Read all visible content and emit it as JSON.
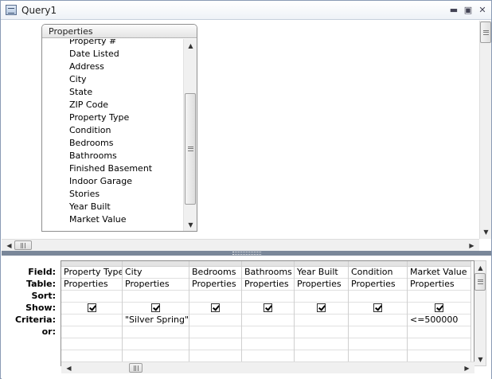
{
  "window": {
    "title": "Query1"
  },
  "field_list": {
    "title": "Properties",
    "items": [
      "Property #",
      "Date Listed",
      "Address",
      "City",
      "State",
      "ZIP Code",
      "Property Type",
      "Condition",
      "Bedrooms",
      "Bathrooms",
      "Finished Basement",
      "Indoor Garage",
      "Stories",
      "Year Built",
      "Market Value"
    ]
  },
  "grid": {
    "row_labels": [
      "Field:",
      "Table:",
      "Sort:",
      "Show:",
      "Criteria:",
      "or:"
    ],
    "columns": [
      {
        "field": "Property Type",
        "table": "Properties",
        "sort": "",
        "show": true,
        "criteria": "",
        "or": ""
      },
      {
        "field": "City",
        "table": "Properties",
        "sort": "",
        "show": true,
        "criteria": "\"Silver Spring\"",
        "or": ""
      },
      {
        "field": "Bedrooms",
        "table": "Properties",
        "sort": "",
        "show": true,
        "criteria": "",
        "or": ""
      },
      {
        "field": "Bathrooms",
        "table": "Properties",
        "sort": "",
        "show": true,
        "criteria": "",
        "or": ""
      },
      {
        "field": "Year Built",
        "table": "Properties",
        "sort": "",
        "show": true,
        "criteria": "",
        "or": ""
      },
      {
        "field": "Condition",
        "table": "Properties",
        "sort": "",
        "show": true,
        "criteria": "",
        "or": ""
      },
      {
        "field": "Market Value",
        "table": "Properties",
        "sort": "",
        "show": true,
        "criteria": "<=500000",
        "or": ""
      }
    ]
  },
  "icons": {
    "window": "query-window-icon",
    "minimize": "minimize-icon",
    "maximize": "maximize-icon",
    "close": "close-icon"
  }
}
